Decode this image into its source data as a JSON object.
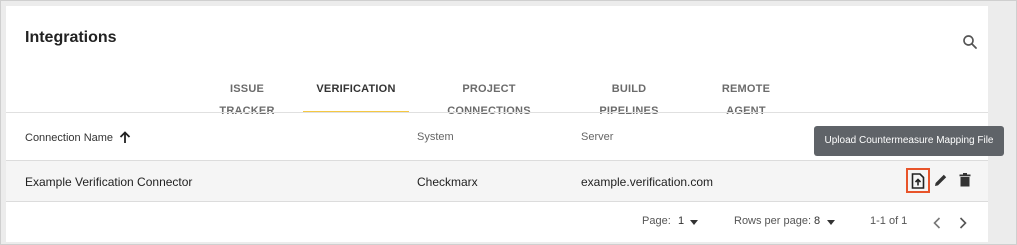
{
  "page": {
    "title": "Integrations"
  },
  "tabs": [
    {
      "label": "ISSUE TRACKER",
      "active": false
    },
    {
      "label": "VERIFICATION",
      "active": true
    },
    {
      "label": "PROJECT CONNECTIONS",
      "active": false
    },
    {
      "label": "BUILD PIPELINES",
      "active": false
    },
    {
      "label": "REMOTE AGENT",
      "active": false
    }
  ],
  "table": {
    "columns": [
      "Connection Name",
      "System",
      "Server"
    ],
    "sort_icon": "arrow-up-icon",
    "rows": [
      {
        "name": "Example Verification Connector",
        "system": "Checkmarx",
        "server": "example.verification.com"
      }
    ]
  },
  "row_actions": {
    "upload_icon": "upload-file-icon",
    "edit_icon": "pencil-icon",
    "delete_icon": "trash-icon"
  },
  "tooltip": {
    "text": "Upload Countermeasure Mapping File"
  },
  "pagination": {
    "page_label": "Page:",
    "page_value": "1",
    "rows_label": "Rows per page:",
    "rows_value": "8",
    "range": "1-1 of 1"
  },
  "colors": {
    "active_tab_underline": "#f5c842",
    "highlight_border": "#e8542a",
    "tooltip_bg": "#5f6368"
  }
}
